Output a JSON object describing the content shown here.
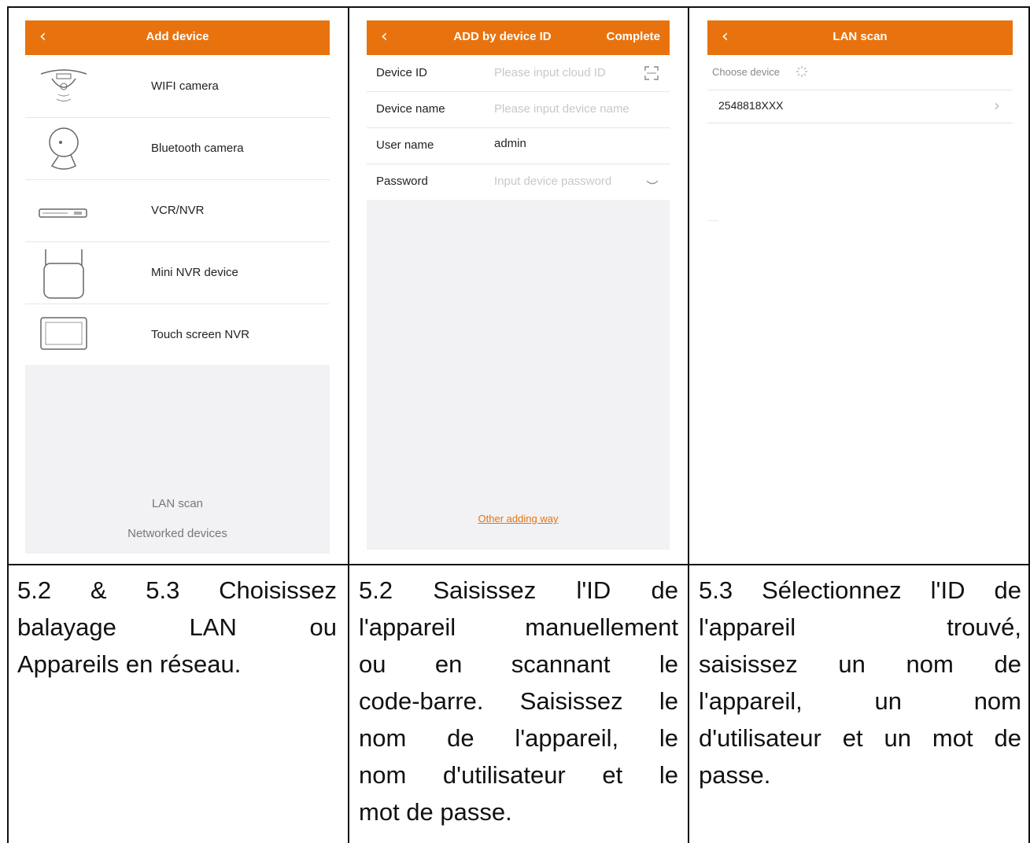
{
  "screens": {
    "add_device": {
      "title": "Add device",
      "back": "‹",
      "items": [
        {
          "label": "WIFI camera",
          "icon": "wifi-camera-icon"
        },
        {
          "label": "Bluetooth camera",
          "icon": "bluetooth-camera-icon"
        },
        {
          "label": "VCR/NVR",
          "icon": "nvr-icon"
        },
        {
          "label": "Mini NVR device",
          "icon": "mini-nvr-icon"
        },
        {
          "label": "Touch screen NVR",
          "icon": "touch-screen-nvr-icon"
        }
      ],
      "lan_scan": "LAN scan",
      "networked": "Networked devices"
    },
    "add_by_id": {
      "title": "ADD by device ID",
      "complete": "Complete",
      "back": "‹",
      "fields": [
        {
          "label": "Device ID",
          "placeholder": "Please input cloud ID",
          "value": ""
        },
        {
          "label": "Device name",
          "placeholder": "Please input device name",
          "value": ""
        },
        {
          "label": "User name",
          "placeholder": "",
          "value": "admin"
        },
        {
          "label": "Password",
          "placeholder": "Input device password",
          "value": ""
        }
      ],
      "other_way": "Other adding way"
    },
    "lan_scan": {
      "title": "LAN scan",
      "back": "‹",
      "choose": "Choose device",
      "device": "2548818XXX",
      "chevron": "›"
    }
  },
  "captions": {
    "col1": [
      "5.2 & 5.3 Choisissez",
      "balayage LAN ou",
      "Appareils en réseau."
    ],
    "col2": [
      "5.2 Saisissez l'ID de",
      "l'appareil manuellement",
      "ou en scannant le",
      "code-barre. Saisissez le",
      "nom de l'appareil, le",
      "nom d'utilisateur et le",
      "mot de passe."
    ],
    "col3": [
      "5.3 Sélectionnez l'ID de",
      "l'appareil trouvé,",
      "saisissez un nom de",
      "l'appareil, un nom",
      "d'utilisateur et un mot de",
      "passe."
    ]
  },
  "colors": {
    "accent": "#e8730e",
    "link": "#e8730e",
    "panel": "#f2f2f4"
  }
}
